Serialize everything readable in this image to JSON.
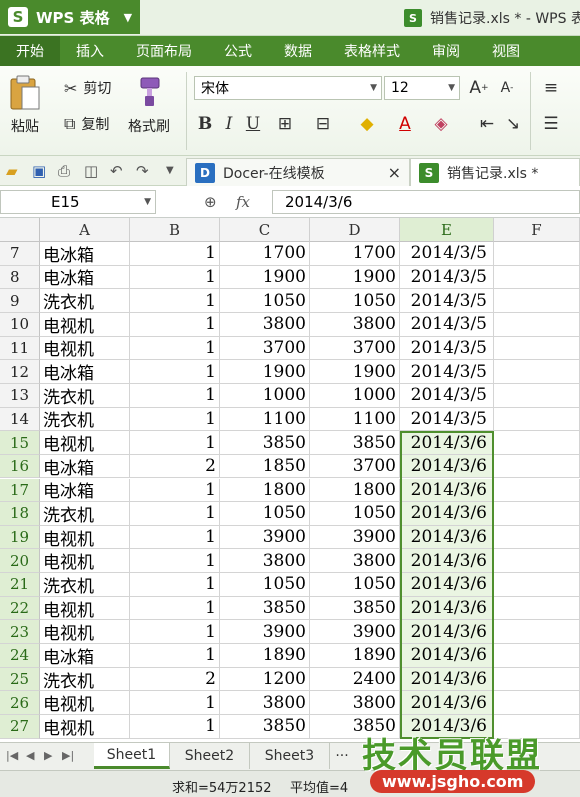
{
  "app": {
    "name": "WPS 表格",
    "logo": "S",
    "window_title": "销售记录.xls * - WPS 表"
  },
  "menu": {
    "tabs": [
      "开始",
      "插入",
      "页面布局",
      "公式",
      "数据",
      "表格样式",
      "审阅",
      "视图"
    ]
  },
  "ribbon": {
    "paste": "粘贴",
    "cut": "剪切",
    "copy": "复制",
    "format_painter": "格式刷",
    "font_name": "宋体",
    "font_size": "12"
  },
  "doc_tabs": [
    {
      "label": "Docer-在线模板",
      "close": "×"
    },
    {
      "label": "销售记录.xls *"
    }
  ],
  "formula_bar": {
    "cell_ref": "E15",
    "fx": "fx",
    "value": "2014/3/6"
  },
  "grid": {
    "columns": [
      "A",
      "B",
      "C",
      "D",
      "E",
      "F"
    ],
    "rows": [
      {
        "n": "7",
        "a": "电冰箱",
        "b": "1",
        "c": "1700",
        "d": "1700",
        "e": "2014/3/5"
      },
      {
        "n": "8",
        "a": "电冰箱",
        "b": "1",
        "c": "1900",
        "d": "1900",
        "e": "2014/3/5"
      },
      {
        "n": "9",
        "a": "洗衣机",
        "b": "1",
        "c": "1050",
        "d": "1050",
        "e": "2014/3/5"
      },
      {
        "n": "10",
        "a": "电视机",
        "b": "1",
        "c": "3800",
        "d": "3800",
        "e": "2014/3/5"
      },
      {
        "n": "11",
        "a": "电视机",
        "b": "1",
        "c": "3700",
        "d": "3700",
        "e": "2014/3/5"
      },
      {
        "n": "12",
        "a": "电冰箱",
        "b": "1",
        "c": "1900",
        "d": "1900",
        "e": "2014/3/5"
      },
      {
        "n": "13",
        "a": "洗衣机",
        "b": "1",
        "c": "1000",
        "d": "1000",
        "e": "2014/3/5"
      },
      {
        "n": "14",
        "a": "洗衣机",
        "b": "1",
        "c": "1100",
        "d": "1100",
        "e": "2014/3/5"
      },
      {
        "n": "15",
        "a": "电视机",
        "b": "1",
        "c": "3850",
        "d": "3850",
        "e": "2014/3/6"
      },
      {
        "n": "16",
        "a": "电冰箱",
        "b": "2",
        "c": "1850",
        "d": "3700",
        "e": "2014/3/6"
      },
      {
        "n": "17",
        "a": "电冰箱",
        "b": "1",
        "c": "1800",
        "d": "1800",
        "e": "2014/3/6"
      },
      {
        "n": "18",
        "a": "洗衣机",
        "b": "1",
        "c": "1050",
        "d": "1050",
        "e": "2014/3/6"
      },
      {
        "n": "19",
        "a": "电视机",
        "b": "1",
        "c": "3900",
        "d": "3900",
        "e": "2014/3/6"
      },
      {
        "n": "20",
        "a": "电视机",
        "b": "1",
        "c": "3800",
        "d": "3800",
        "e": "2014/3/6"
      },
      {
        "n": "21",
        "a": "洗衣机",
        "b": "1",
        "c": "1050",
        "d": "1050",
        "e": "2014/3/6"
      },
      {
        "n": "22",
        "a": "电视机",
        "b": "1",
        "c": "3850",
        "d": "3850",
        "e": "2014/3/6"
      },
      {
        "n": "23",
        "a": "电视机",
        "b": "1",
        "c": "3900",
        "d": "3900",
        "e": "2014/3/6"
      },
      {
        "n": "24",
        "a": "电冰箱",
        "b": "1",
        "c": "1890",
        "d": "1890",
        "e": "2014/3/6"
      },
      {
        "n": "25",
        "a": "洗衣机",
        "b": "2",
        "c": "1200",
        "d": "2400",
        "e": "2014/3/6"
      },
      {
        "n": "26",
        "a": "电视机",
        "b": "1",
        "c": "3800",
        "d": "3800",
        "e": "2014/3/6"
      },
      {
        "n": "27",
        "a": "电视机",
        "b": "1",
        "c": "3850",
        "d": "3850",
        "e": "2014/3/6"
      }
    ]
  },
  "sheets": {
    "tabs": [
      "Sheet1",
      "Sheet2",
      "Sheet3"
    ],
    "more": "···"
  },
  "status": {
    "sum": "求和=54万2152",
    "avg": "平均值=4"
  },
  "watermark": {
    "text": "技术员联盟",
    "url": "www.jsgho.com"
  },
  "colors": {
    "accent": "#4a8a2c",
    "selection": "#4f8f2e"
  }
}
